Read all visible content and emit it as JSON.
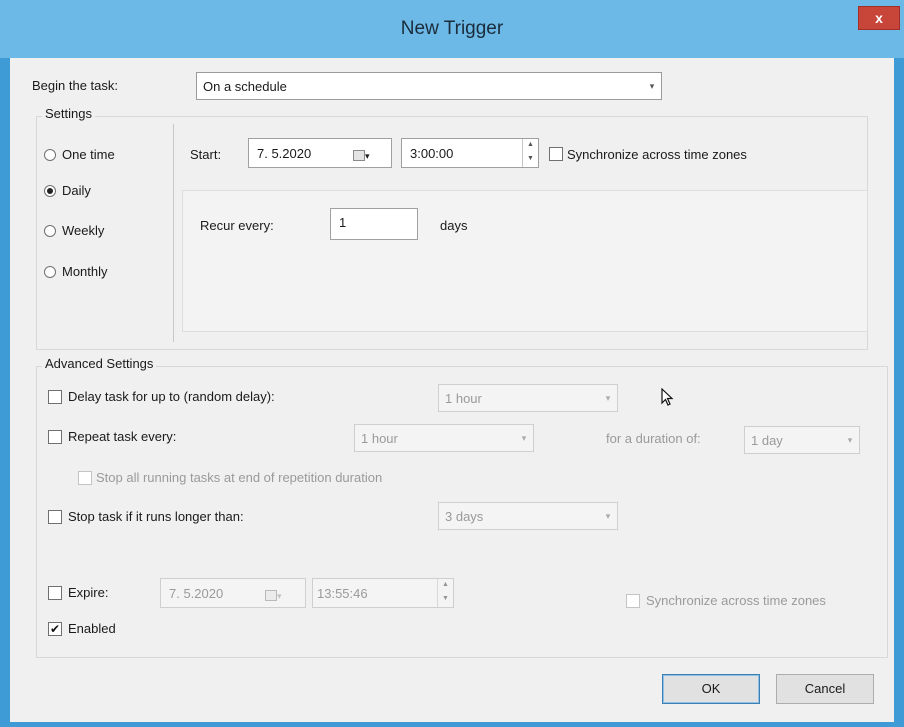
{
  "window": {
    "title": "New Trigger",
    "close_glyph": "x"
  },
  "begin_task": {
    "label": "Begin the task:",
    "value": "On a schedule"
  },
  "settings": {
    "legend": "Settings",
    "radios": [
      {
        "label": "One time",
        "selected": false
      },
      {
        "label": "Daily",
        "selected": true
      },
      {
        "label": "Weekly",
        "selected": false
      },
      {
        "label": "Monthly",
        "selected": false
      }
    ],
    "start": {
      "label": "Start:",
      "date": "7. 5.2020",
      "time": "3:00:00"
    },
    "sync_label": "Synchronize across time zones",
    "recur": {
      "label": "Recur every:",
      "value": "1",
      "unit": "days"
    }
  },
  "advanced": {
    "legend": "Advanced Settings",
    "delay": {
      "label": "Delay task for up to (random delay):",
      "value": "1 hour"
    },
    "repeat": {
      "label": "Repeat task every:",
      "value": "1 hour",
      "duration_label": "for a duration of:",
      "duration_value": "1 day"
    },
    "stop_all_label": "Stop all running tasks at end of repetition duration",
    "stop_longer": {
      "label": "Stop task if it runs longer than:",
      "value": "3 days"
    },
    "expire": {
      "label": "Expire:",
      "date": "7. 5.2020",
      "time": "13:55:46"
    },
    "expire_sync_label": "Synchronize across time zones",
    "enabled": {
      "label": "Enabled",
      "checked": true
    }
  },
  "buttons": {
    "ok": "OK",
    "cancel": "Cancel"
  },
  "icons": {
    "check_glyph": "✔",
    "arrow_glyph": "▾",
    "spin_up": "▲",
    "spin_down": "▼",
    "cursor": "arrow-cursor-icon"
  }
}
